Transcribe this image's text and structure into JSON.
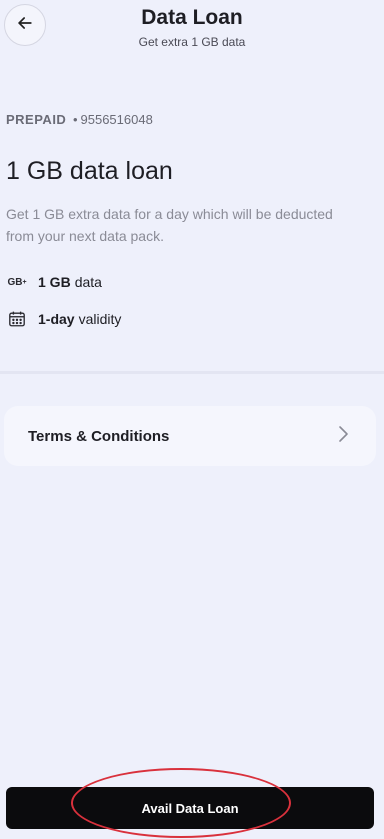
{
  "header": {
    "title": "Data Loan",
    "subtitle": "Get extra 1 GB data",
    "back_icon": "arrow-left-icon"
  },
  "account": {
    "type": "PREPAID",
    "separator": "•",
    "number": "9556516048"
  },
  "loan": {
    "title": "1 GB data loan",
    "description": "Get 1 GB extra data for a day which will be deducted from your next data pack."
  },
  "features": [
    {
      "icon": "gb-data-icon",
      "icon_text": "GB",
      "icon_sup": "+",
      "bold": "1 GB",
      "text": "data"
    },
    {
      "icon": "calendar-icon",
      "bold": "1-day",
      "text": "validity"
    }
  ],
  "terms": {
    "label": "Terms & Conditions",
    "icon": "chevron-right-icon"
  },
  "cta": {
    "label": "Avail Data Loan"
  },
  "colors": {
    "background": "#eef0fb",
    "card": "#f5f6fd",
    "cta_bg": "#0b0b0d",
    "annotation": "#d9313c"
  }
}
